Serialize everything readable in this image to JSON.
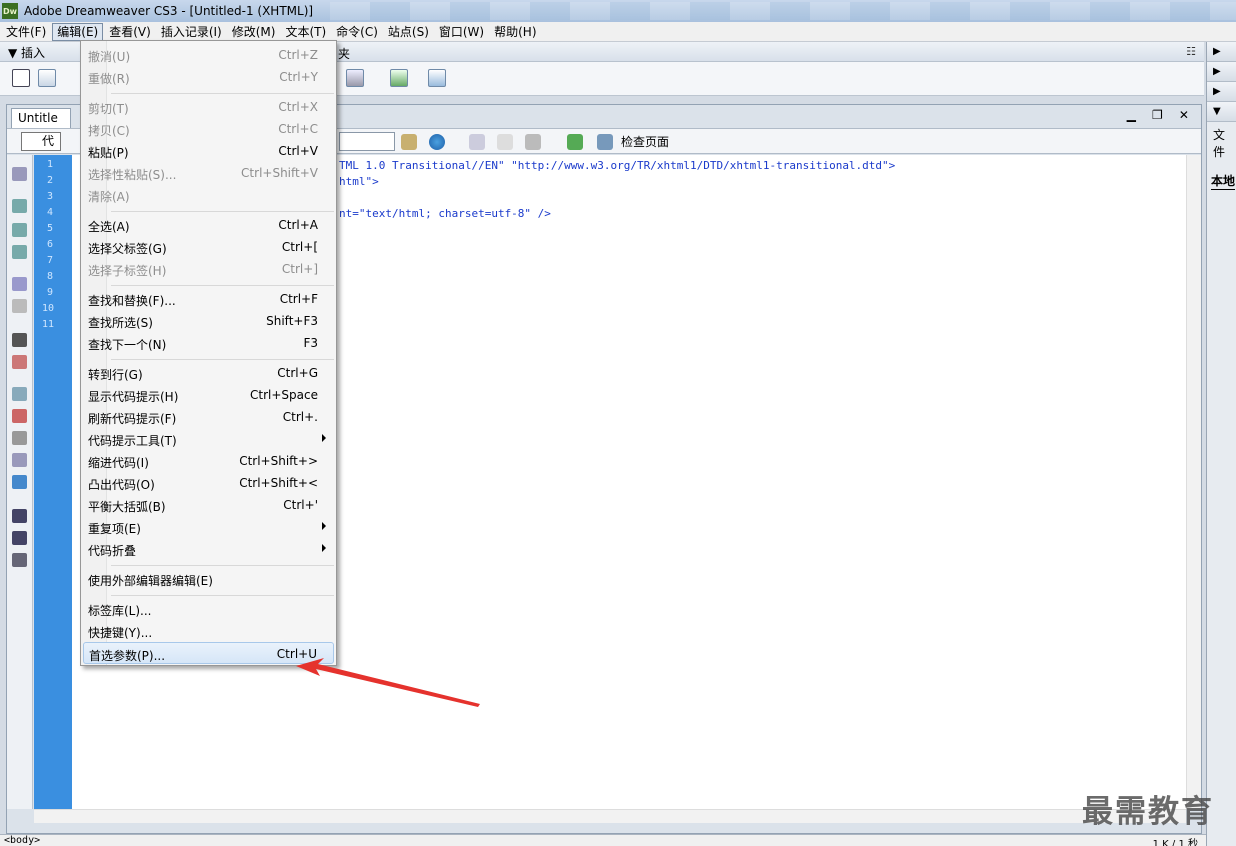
{
  "window": {
    "title": "Adobe Dreamweaver CS3 - [Untitled-1 (XHTML)]",
    "logo": "Dw"
  },
  "menubar": [
    "文件(F)",
    "编辑(E)",
    "查看(V)",
    "插入记录(I)",
    "修改(M)",
    "文本(T)",
    "命令(C)",
    "站点(S)",
    "窗口(W)",
    "帮助(H)"
  ],
  "insertbar": {
    "label": "▼ 插入",
    "tail": "夹",
    "options": "☷"
  },
  "document": {
    "tab": "Untitle",
    "code_button": "代",
    "check_page": "检查页面",
    "window_controls": "▁ ❐ ✕"
  },
  "line_numbers": [
    "1",
    "2",
    "3",
    "4",
    "5",
    "6",
    "7",
    "8",
    "9",
    "10",
    "11"
  ],
  "code_lines": [
    "TML 1.0 Transitional//EN\" \"http://www.w3.org/TR/xhtml1/DTD/xhtml1-transitional.dtd\">",
    "html\">",
    "",
    "nt=\"text/html; charset=utf-8\" />"
  ],
  "right_panel": {
    "files_label": "文件",
    "local_label": "本地"
  },
  "statusbar": {
    "tag": "<body>",
    "size": "1 K / 1 秒"
  },
  "edit_menu": {
    "items": [
      {
        "label": "撤消(U)",
        "shortcut": "Ctrl+Z",
        "disabled": true
      },
      {
        "label": "重做(R)",
        "shortcut": "Ctrl+Y",
        "disabled": true
      },
      {
        "label": "剪切(T)",
        "shortcut": "Ctrl+X",
        "disabled": true
      },
      {
        "label": "拷贝(C)",
        "shortcut": "Ctrl+C",
        "disabled": true
      },
      {
        "label": "粘贴(P)",
        "shortcut": "Ctrl+V",
        "disabled": false
      },
      {
        "label": "选择性粘贴(S)...",
        "shortcut": "Ctrl+Shift+V",
        "disabled": true
      },
      {
        "label": "清除(A)",
        "shortcut": "",
        "disabled": true
      },
      {
        "label": "全选(A)",
        "shortcut": "Ctrl+A",
        "disabled": false
      },
      {
        "label": "选择父标签(G)",
        "shortcut": "Ctrl+[",
        "disabled": false
      },
      {
        "label": "选择子标签(H)",
        "shortcut": "Ctrl+]",
        "disabled": true
      },
      {
        "label": "查找和替换(F)...",
        "shortcut": "Ctrl+F",
        "disabled": false
      },
      {
        "label": "查找所选(S)",
        "shortcut": "Shift+F3",
        "disabled": false
      },
      {
        "label": "查找下一个(N)",
        "shortcut": "F3",
        "disabled": false
      },
      {
        "label": "转到行(G)",
        "shortcut": "Ctrl+G",
        "disabled": false
      },
      {
        "label": "显示代码提示(H)",
        "shortcut": "Ctrl+Space",
        "disabled": false
      },
      {
        "label": "刷新代码提示(F)",
        "shortcut": "Ctrl+.",
        "disabled": false
      },
      {
        "label": "代码提示工具(T)",
        "shortcut": "",
        "disabled": false
      },
      {
        "label": "缩进代码(I)",
        "shortcut": "Ctrl+Shift+>",
        "disabled": false
      },
      {
        "label": "凸出代码(O)",
        "shortcut": "Ctrl+Shift+<",
        "disabled": false
      },
      {
        "label": "平衡大括弧(B)",
        "shortcut": "Ctrl+'",
        "disabled": false
      },
      {
        "label": "重复项(E)",
        "shortcut": "",
        "disabled": false
      },
      {
        "label": "代码折叠",
        "shortcut": "",
        "disabled": false
      },
      {
        "label": "使用外部编辑器编辑(E)",
        "shortcut": "",
        "disabled": false
      },
      {
        "label": "标签库(L)...",
        "shortcut": "",
        "disabled": false
      },
      {
        "label": "快捷键(Y)...",
        "shortcut": "",
        "disabled": false
      },
      {
        "label": "首选参数(P)...",
        "shortcut": "Ctrl+U",
        "disabled": false
      }
    ]
  },
  "watermark": "最需教育",
  "colors": {
    "gutter": "#3a8fe0",
    "code_text": "#1a3acb",
    "annotation_arrow": "#e5322d"
  }
}
